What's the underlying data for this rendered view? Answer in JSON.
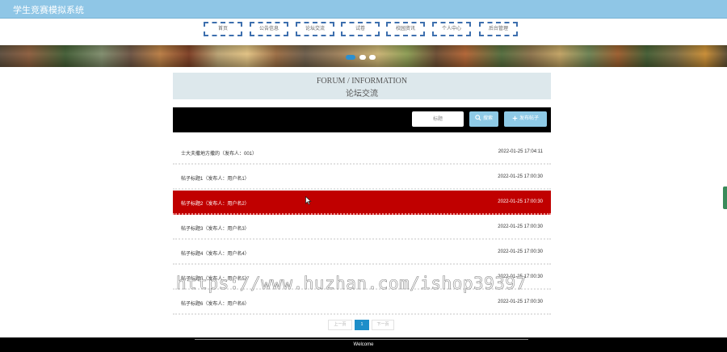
{
  "site": {
    "title": "学生竞赛模拟系统"
  },
  "nav": {
    "items": [
      {
        "label": "首页"
      },
      {
        "label": "公告信息"
      },
      {
        "label": "论坛交流"
      },
      {
        "label": "试卷"
      },
      {
        "label": "校园资讯"
      },
      {
        "label": "个人中心"
      },
      {
        "label": "后台管理"
      }
    ]
  },
  "section": {
    "title_en": "FORUM / INFORMATION",
    "title_cn": "论坛交流"
  },
  "search": {
    "placeholder": "标题",
    "search_label": "搜索",
    "post_label": "发布帖子"
  },
  "posts": [
    {
      "title": "士大夫撒地方撒的（发布人：001）",
      "time": "2022-01-25 17:04:11"
    },
    {
      "title": "帖子标题1（发布人：用户名1）",
      "time": "2022-01-25 17:00:30"
    },
    {
      "title": "帖子标题2（发布人：用户名2）",
      "time": "2022-01-25 17:00:30"
    },
    {
      "title": "帖子标题3（发布人：用户名3）",
      "time": "2022-01-25 17:00:30"
    },
    {
      "title": "帖子标题4（发布人：用户名4）",
      "time": "2022-01-25 17:00:30"
    },
    {
      "title": "帖子标题5（发布人：用户名5）",
      "time": "2022-01-25 17:00:30"
    },
    {
      "title": "帖子标题6（发布人：用户名6）",
      "time": "2022-01-25 17:00:30"
    }
  ],
  "pagination": {
    "prev": "上一页",
    "current": "1",
    "next": "下一页"
  },
  "watermark": "https://www.huzhan.com/ishop39397",
  "footer": {
    "text": "Welcome"
  },
  "colors": {
    "topbar": "#8fc6e6",
    "highlight_row": "#c00000",
    "button": "#8ecae6",
    "page_active": "#1d8ec9"
  },
  "icons": {
    "search_button": "search-icon",
    "post_button": "plus-icon"
  }
}
